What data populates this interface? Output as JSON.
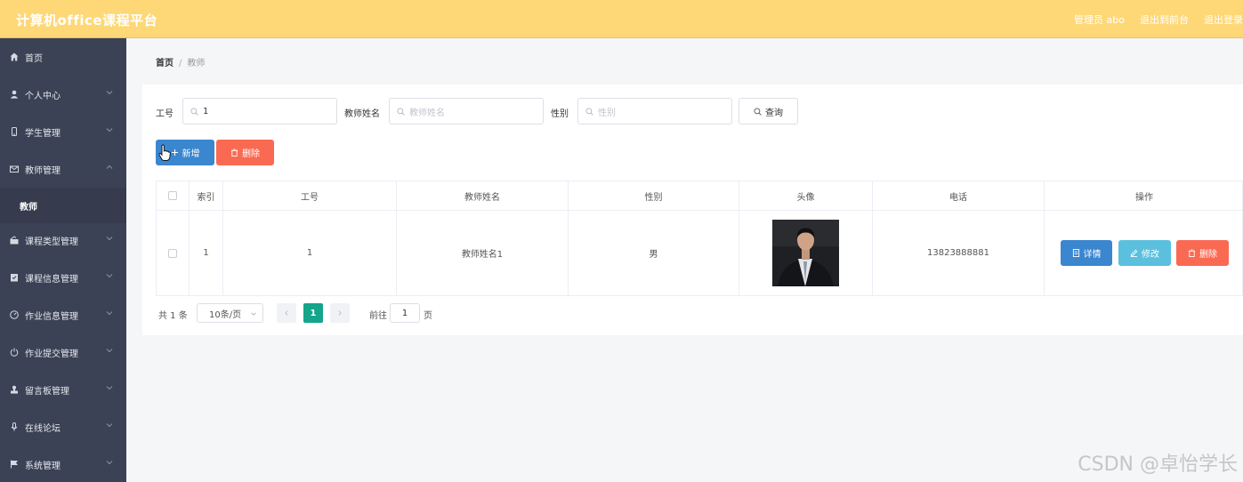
{
  "app": {
    "title": "计算机office课程平台",
    "header_links": [
      "管理员 abo",
      "退出到前台",
      "退出登录"
    ]
  },
  "sidebar": {
    "items": [
      {
        "label": "首页",
        "icon": "home-icon",
        "expandable": false
      },
      {
        "label": "个人中心",
        "icon": "user-icon",
        "expandable": true
      },
      {
        "label": "学生管理",
        "icon": "mobile-icon",
        "expandable": true
      },
      {
        "label": "教师管理",
        "icon": "mail-icon",
        "expandable": true,
        "expanded": true
      },
      {
        "label": "课程类型管理",
        "icon": "chart-icon",
        "expandable": true
      },
      {
        "label": "课程信息管理",
        "icon": "clipboard-icon",
        "expandable": true
      },
      {
        "label": "作业信息管理",
        "icon": "gauge-icon",
        "expandable": true
      },
      {
        "label": "作业提交管理",
        "icon": "power-icon",
        "expandable": true
      },
      {
        "label": "留言板管理",
        "icon": "stamp-icon",
        "expandable": true
      },
      {
        "label": "在线论坛",
        "icon": "mic-icon",
        "expandable": true
      },
      {
        "label": "系统管理",
        "icon": "flag-icon",
        "expandable": true
      }
    ],
    "active_sub": "教师"
  },
  "breadcrumb": {
    "home": "首页",
    "separator": "/",
    "current": "教师"
  },
  "search": {
    "gonghao_label": "工号",
    "gonghao_value": "1",
    "name_label": "教师姓名",
    "name_placeholder": "教师姓名",
    "gender_label": "性别",
    "gender_placeholder": "性别",
    "query_label": "查询"
  },
  "actions": {
    "add_label": "新增",
    "delete_label": "删除"
  },
  "table": {
    "headers": [
      "索引",
      "工号",
      "教师姓名",
      "性别",
      "头像",
      "电话",
      "操作"
    ],
    "rows": [
      {
        "index": "1",
        "gonghao": "1",
        "name": "教师姓名1",
        "gender": "男",
        "phone": "13823888881"
      }
    ],
    "row_actions": {
      "detail": "详情",
      "edit": "修改",
      "delete": "删除"
    }
  },
  "pagination": {
    "total": "共 1 条",
    "page_size": "10条/页",
    "current_page": "1",
    "goto_label": "前往",
    "goto_value": "1",
    "page_suffix": "页"
  },
  "watermark": "CSDN @卓怡学长",
  "colors": {
    "header_bg": "#fed877",
    "sidebar_bg": "#3b4255",
    "primary": "#3a86cf",
    "danger": "#fa6a53",
    "info": "#5bc0de",
    "pager_active": "#14a58b"
  }
}
